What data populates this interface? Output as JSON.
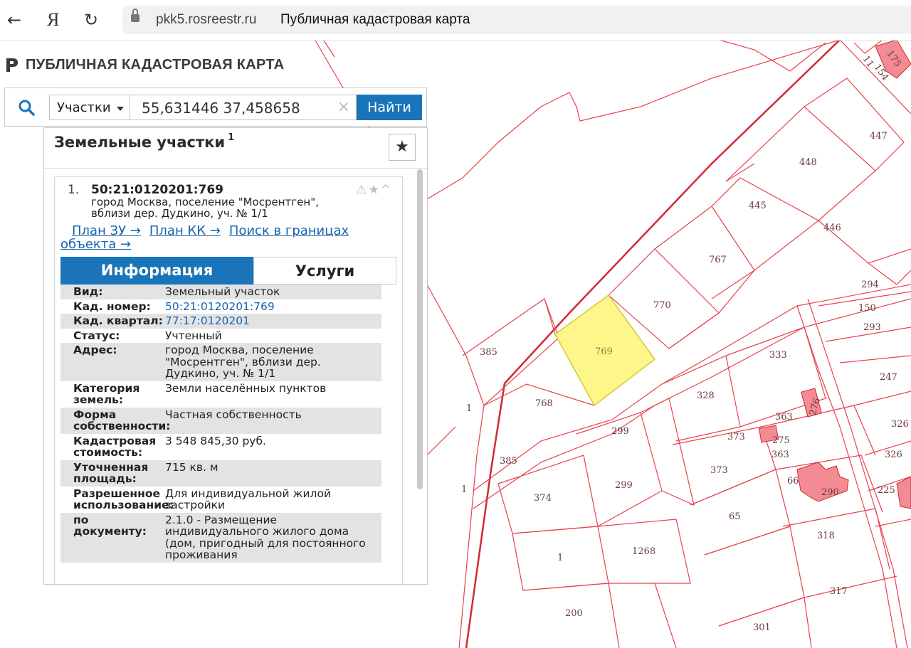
{
  "browser": {
    "back_icon": "arrow-left-icon",
    "yandex_label": "Я",
    "reload_icon": "reload-icon",
    "domain": "pkk5.rosreestr.ru",
    "title": "Публичная кадастровая карта"
  },
  "app": {
    "title": "ПУБЛИЧНАЯ КАДАСТРОВАЯ КАРТА"
  },
  "search": {
    "type_label": "Участки",
    "query": "55,631446 37,458658",
    "clear_label": "×",
    "find_label": "Найти"
  },
  "panel": {
    "title": "Земельные участки",
    "count": "1",
    "fav_label": "★",
    "card": {
      "num": "1.",
      "cad_number": "50:21:0120201:769",
      "address": "город Москва, поселение \"Мосрентген\", вблизи дер. Дудкино, уч. № 1/1",
      "icons": "⚠★^",
      "links": {
        "plan_zu": "План ЗУ →",
        "plan_kk": "План КК →",
        "search_bounds": "Поиск в границах объекта →"
      },
      "tabs": {
        "info": "Информация",
        "services": "Услуги"
      },
      "rows": [
        {
          "k": "Вид:",
          "v": "Земельный участок"
        },
        {
          "k": "Кад. номер:",
          "v": "50:21:0120201:769"
        },
        {
          "k": "Кад. квартал:",
          "v": "77:17:0120201"
        },
        {
          "k": "Статус:",
          "v": "Учтенный"
        },
        {
          "k": "Адрес:",
          "v": "город Москва, поселение \"Мосрентген\", вблизи дер. Дудкино, уч. № 1/1"
        },
        {
          "k": "Категория земель:",
          "v": "Земли населённых пунктов"
        },
        {
          "k": "Форма собственности:",
          "v": "Частная собственность"
        },
        {
          "k": "Кадастровая стоимость:",
          "v": "3 548 845,30 руб."
        },
        {
          "k": "Уточненная площадь:",
          "v": "715 кв. м"
        },
        {
          "k": "Разрешенное использование:",
          "v": "Для индивидуальной жилой застройки"
        },
        {
          "k": "по документу:",
          "v": "2.1.0 - Размещение индивидуального жилого дома (дом, пригодный для постоянного проживания"
        }
      ]
    }
  },
  "map": {
    "selected_plot": "769",
    "plots": [
      "1",
      "1",
      "385",
      "385",
      "768",
      "769",
      "770",
      "767",
      "445",
      "446",
      "447",
      "448",
      "299",
      "299",
      "328",
      "333",
      "373",
      "373",
      "363",
      "363",
      "275",
      "276",
      "65",
      "66",
      "290",
      "374",
      "1",
      "1268",
      "200",
      "318",
      "317",
      "301",
      "294",
      "150",
      "293",
      "247",
      "326",
      "326",
      "225",
      "11",
      "154",
      "175"
    ],
    "line_color": "#e8414b",
    "highlight_color": "#fdf78a"
  }
}
